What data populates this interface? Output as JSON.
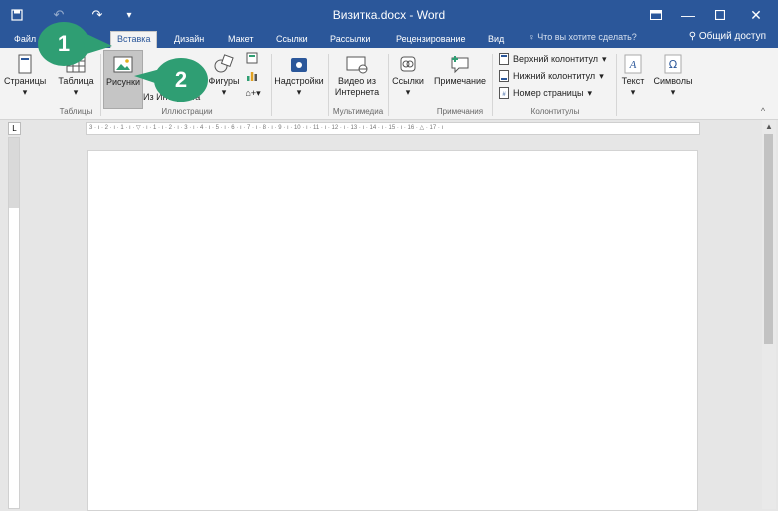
{
  "window": {
    "title": "Визитка.docx - Word",
    "qat_icons": [
      "save-icon",
      "undo-icon",
      "redo-icon",
      "customize-icon"
    ],
    "controls": [
      "ribbon-display-icon",
      "minimize-icon",
      "maximize-icon",
      "close-icon"
    ]
  },
  "tabs": [
    "Файл",
    "Вставка",
    "Дизайн",
    "Макет",
    "Ссылки",
    "Рассылки",
    "Рецензирование",
    "Вид"
  ],
  "active_tab": "Вставка",
  "tell_me": "Что вы хотите сделать?",
  "share": "Общий доступ",
  "ribbon": {
    "pages": "Страницы",
    "table": "Таблица",
    "pictures": "Рисунки",
    "online_pictures": "Из Интернета",
    "shapes": "Фигуры",
    "addins": "Надстройки",
    "video_l1": "Видео из",
    "video_l2": "Интернета",
    "links": "Ссылки",
    "comment": "Примечание",
    "header": "Верхний колонтитул",
    "footer": "Нижний колонтитул",
    "page_number": "Номер страницы",
    "text": "Текст",
    "symbols": "Символы",
    "groups": {
      "tables": "Таблицы",
      "illustrations": "Иллюстрации",
      "media": "Мультимедиа",
      "comments": "Примечания",
      "headers": "Колонтитулы"
    }
  },
  "ruler": {
    "text": "3 · ı · 2 · ı · 1 · ı · ▽ · ı · 1 · ı · 2 · ı · 3 · ı · 4 · ı · 5 · ı · 6 · ı · 7 · ı · 8 · ı · 9 · ı · 10 · ı · 11 · ı · 12 · ı · 13 · ı · 14 · ı · 15 · ı · 16 · △ · 17 · ı"
  },
  "callouts": [
    "1",
    "2"
  ],
  "colors": {
    "accent": "#2b579a",
    "callout": "#2f9e73"
  }
}
